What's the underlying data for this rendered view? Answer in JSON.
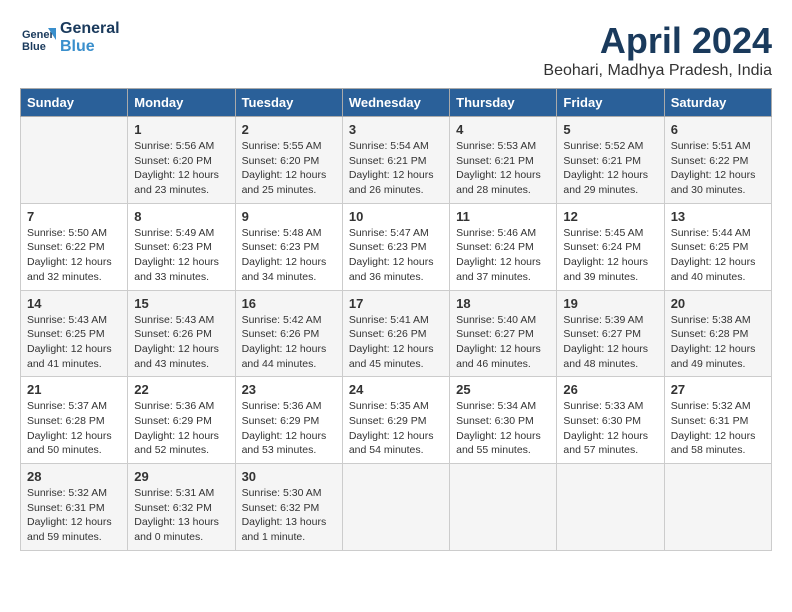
{
  "header": {
    "logo_line1": "General",
    "logo_line2": "Blue",
    "month": "April 2024",
    "location": "Beohari, Madhya Pradesh, India"
  },
  "days_of_week": [
    "Sunday",
    "Monday",
    "Tuesday",
    "Wednesday",
    "Thursday",
    "Friday",
    "Saturday"
  ],
  "weeks": [
    [
      {
        "day": "",
        "info": ""
      },
      {
        "day": "1",
        "info": "Sunrise: 5:56 AM\nSunset: 6:20 PM\nDaylight: 12 hours\nand 23 minutes."
      },
      {
        "day": "2",
        "info": "Sunrise: 5:55 AM\nSunset: 6:20 PM\nDaylight: 12 hours\nand 25 minutes."
      },
      {
        "day": "3",
        "info": "Sunrise: 5:54 AM\nSunset: 6:21 PM\nDaylight: 12 hours\nand 26 minutes."
      },
      {
        "day": "4",
        "info": "Sunrise: 5:53 AM\nSunset: 6:21 PM\nDaylight: 12 hours\nand 28 minutes."
      },
      {
        "day": "5",
        "info": "Sunrise: 5:52 AM\nSunset: 6:21 PM\nDaylight: 12 hours\nand 29 minutes."
      },
      {
        "day": "6",
        "info": "Sunrise: 5:51 AM\nSunset: 6:22 PM\nDaylight: 12 hours\nand 30 minutes."
      }
    ],
    [
      {
        "day": "7",
        "info": "Sunrise: 5:50 AM\nSunset: 6:22 PM\nDaylight: 12 hours\nand 32 minutes."
      },
      {
        "day": "8",
        "info": "Sunrise: 5:49 AM\nSunset: 6:23 PM\nDaylight: 12 hours\nand 33 minutes."
      },
      {
        "day": "9",
        "info": "Sunrise: 5:48 AM\nSunset: 6:23 PM\nDaylight: 12 hours\nand 34 minutes."
      },
      {
        "day": "10",
        "info": "Sunrise: 5:47 AM\nSunset: 6:23 PM\nDaylight: 12 hours\nand 36 minutes."
      },
      {
        "day": "11",
        "info": "Sunrise: 5:46 AM\nSunset: 6:24 PM\nDaylight: 12 hours\nand 37 minutes."
      },
      {
        "day": "12",
        "info": "Sunrise: 5:45 AM\nSunset: 6:24 PM\nDaylight: 12 hours\nand 39 minutes."
      },
      {
        "day": "13",
        "info": "Sunrise: 5:44 AM\nSunset: 6:25 PM\nDaylight: 12 hours\nand 40 minutes."
      }
    ],
    [
      {
        "day": "14",
        "info": "Sunrise: 5:43 AM\nSunset: 6:25 PM\nDaylight: 12 hours\nand 41 minutes."
      },
      {
        "day": "15",
        "info": "Sunrise: 5:43 AM\nSunset: 6:26 PM\nDaylight: 12 hours\nand 43 minutes."
      },
      {
        "day": "16",
        "info": "Sunrise: 5:42 AM\nSunset: 6:26 PM\nDaylight: 12 hours\nand 44 minutes."
      },
      {
        "day": "17",
        "info": "Sunrise: 5:41 AM\nSunset: 6:26 PM\nDaylight: 12 hours\nand 45 minutes."
      },
      {
        "day": "18",
        "info": "Sunrise: 5:40 AM\nSunset: 6:27 PM\nDaylight: 12 hours\nand 46 minutes."
      },
      {
        "day": "19",
        "info": "Sunrise: 5:39 AM\nSunset: 6:27 PM\nDaylight: 12 hours\nand 48 minutes."
      },
      {
        "day": "20",
        "info": "Sunrise: 5:38 AM\nSunset: 6:28 PM\nDaylight: 12 hours\nand 49 minutes."
      }
    ],
    [
      {
        "day": "21",
        "info": "Sunrise: 5:37 AM\nSunset: 6:28 PM\nDaylight: 12 hours\nand 50 minutes."
      },
      {
        "day": "22",
        "info": "Sunrise: 5:36 AM\nSunset: 6:29 PM\nDaylight: 12 hours\nand 52 minutes."
      },
      {
        "day": "23",
        "info": "Sunrise: 5:36 AM\nSunset: 6:29 PM\nDaylight: 12 hours\nand 53 minutes."
      },
      {
        "day": "24",
        "info": "Sunrise: 5:35 AM\nSunset: 6:29 PM\nDaylight: 12 hours\nand 54 minutes."
      },
      {
        "day": "25",
        "info": "Sunrise: 5:34 AM\nSunset: 6:30 PM\nDaylight: 12 hours\nand 55 minutes."
      },
      {
        "day": "26",
        "info": "Sunrise: 5:33 AM\nSunset: 6:30 PM\nDaylight: 12 hours\nand 57 minutes."
      },
      {
        "day": "27",
        "info": "Sunrise: 5:32 AM\nSunset: 6:31 PM\nDaylight: 12 hours\nand 58 minutes."
      }
    ],
    [
      {
        "day": "28",
        "info": "Sunrise: 5:32 AM\nSunset: 6:31 PM\nDaylight: 12 hours\nand 59 minutes."
      },
      {
        "day": "29",
        "info": "Sunrise: 5:31 AM\nSunset: 6:32 PM\nDaylight: 13 hours\nand 0 minutes."
      },
      {
        "day": "30",
        "info": "Sunrise: 5:30 AM\nSunset: 6:32 PM\nDaylight: 13 hours\nand 1 minute."
      },
      {
        "day": "",
        "info": ""
      },
      {
        "day": "",
        "info": ""
      },
      {
        "day": "",
        "info": ""
      },
      {
        "day": "",
        "info": ""
      }
    ]
  ]
}
